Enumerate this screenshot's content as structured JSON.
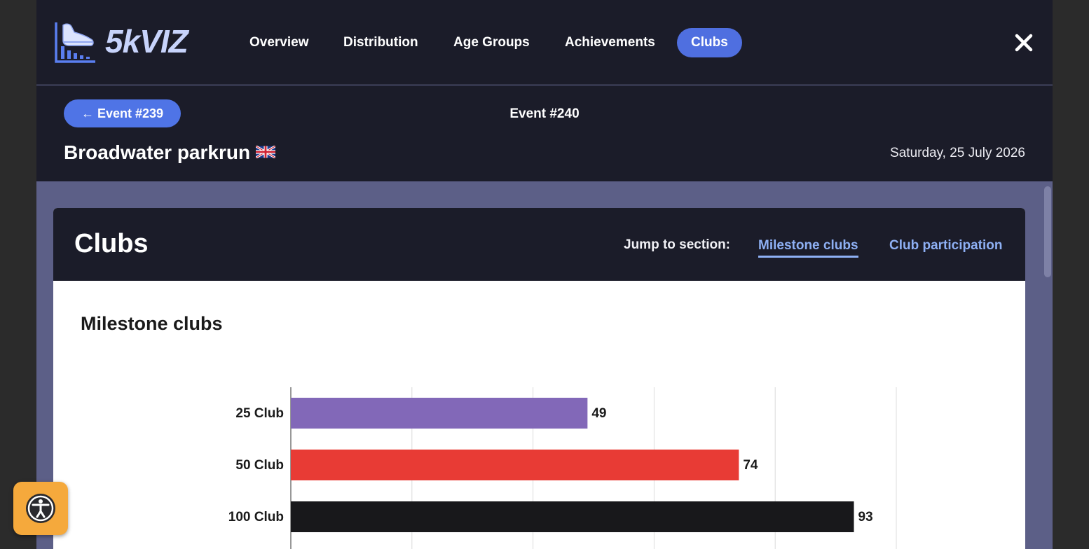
{
  "app": {
    "logo_text": "5kVIZ"
  },
  "nav": {
    "items": [
      {
        "label": "Overview",
        "active": false
      },
      {
        "label": "Distribution",
        "active": false
      },
      {
        "label": "Age Groups",
        "active": false
      },
      {
        "label": "Achievements",
        "active": false
      },
      {
        "label": "Clubs",
        "active": true
      }
    ],
    "close_icon": "close-icon"
  },
  "event": {
    "prev_label": "← Event #239",
    "number": "Event #240",
    "name": "Broadwater parkrun",
    "flag_icon": "uk-flag-icon",
    "date": "Saturday, 25 July 2026"
  },
  "clubs": {
    "title": "Clubs",
    "jump_label": "Jump to section:",
    "jump_links": [
      {
        "label": "Milestone clubs",
        "active": true
      },
      {
        "label": "Club participation",
        "active": false
      }
    ]
  },
  "milestone": {
    "title": "Milestone clubs"
  },
  "chart_data": {
    "type": "bar",
    "orientation": "horizontal",
    "categories": [
      "25 Club",
      "50 Club",
      "100 Club"
    ],
    "values": [
      49,
      74,
      93
    ],
    "colors": [
      "#8268b8",
      "#e83b35",
      "#18181b"
    ],
    "xlim": [
      0,
      100
    ],
    "grid": true,
    "data_labels": true
  },
  "colors": {
    "nav_bg": "#1b1c29",
    "accent": "#4f6fe0",
    "page_bg": "#5c5f87",
    "link": "#8eb0f4",
    "a11y": "#f5a93c"
  },
  "accessibility": {
    "icon": "accessibility-icon"
  }
}
